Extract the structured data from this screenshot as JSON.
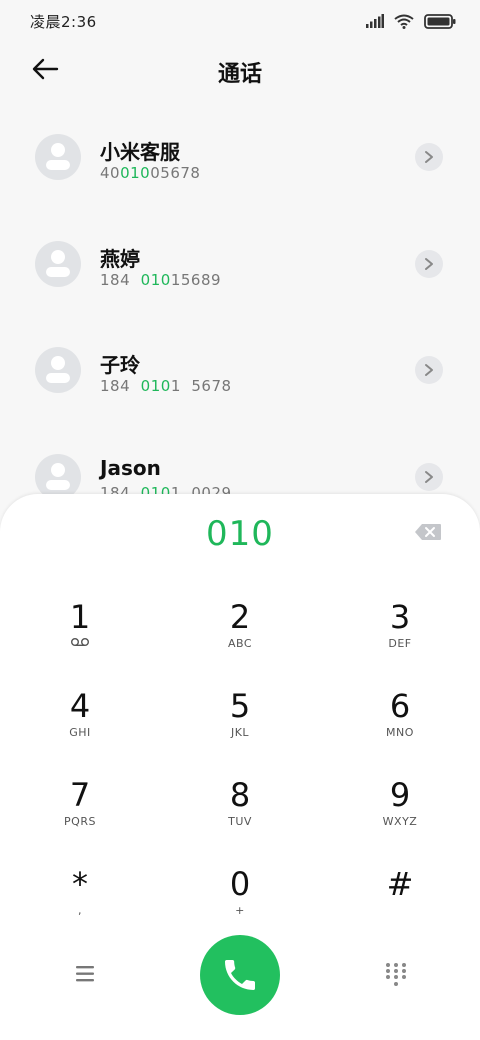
{
  "status_bar": {
    "time": "凌晨2:36"
  },
  "header": {
    "title": "通话"
  },
  "contacts": [
    {
      "name": "小米客服",
      "number_pre": "40",
      "number_match": "010",
      "number_post": "05678"
    },
    {
      "name": "燕婷",
      "number_pre": "184  ",
      "number_match": "010",
      "number_post": "15689"
    },
    {
      "name": "子玲",
      "number_pre": "184  ",
      "number_match": "010",
      "number_post": "1  5678"
    },
    {
      "name": "Jason",
      "number_pre": "184  ",
      "number_match": "010",
      "number_post": "1  0029"
    }
  ],
  "dialer": {
    "input": "010",
    "keys": [
      {
        "digit": "1",
        "letters": ""
      },
      {
        "digit": "2",
        "letters": "ABC"
      },
      {
        "digit": "3",
        "letters": "DEF"
      },
      {
        "digit": "4",
        "letters": "GHI"
      },
      {
        "digit": "5",
        "letters": "JKL"
      },
      {
        "digit": "6",
        "letters": "MNO"
      },
      {
        "digit": "7",
        "letters": "PQRS"
      },
      {
        "digit": "8",
        "letters": "TUV"
      },
      {
        "digit": "9",
        "letters": "WXYZ"
      },
      {
        "digit": "*",
        "letters": ","
      },
      {
        "digit": "0",
        "letters": "+"
      },
      {
        "digit": "#",
        "letters": ""
      }
    ]
  },
  "colors": {
    "accent": "#1fb75a",
    "call_button": "#22c05f",
    "background": "#f7f7f7"
  },
  "icons": {
    "back": "back-arrow-icon",
    "detail": "chevron-right-icon",
    "backspace": "backspace-icon",
    "voicemail": "voicemail-icon",
    "menu": "menu-icon",
    "call": "phone-icon",
    "keypad": "dialpad-icon"
  }
}
